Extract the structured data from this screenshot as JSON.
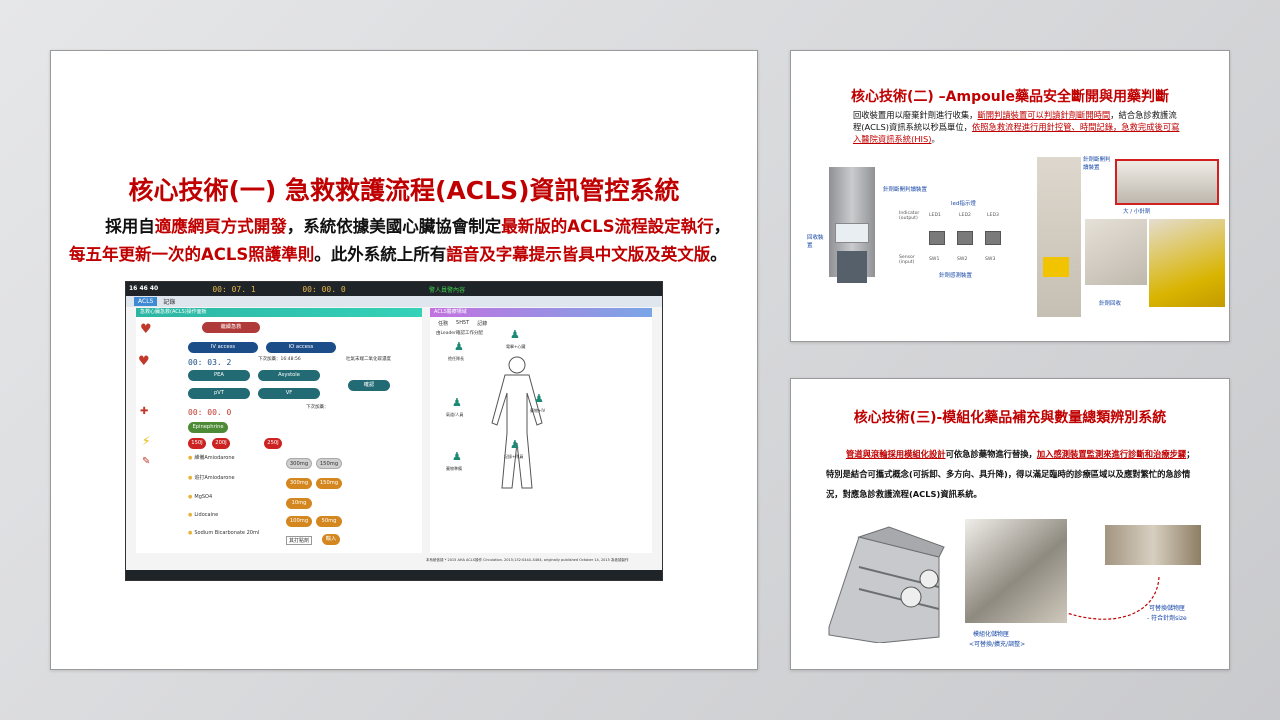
{
  "slide1": {
    "title": "核心技術(一) 急救救護流程(ACLS)資訊管控系統",
    "body": {
      "p1_a": "採用自",
      "p1_b": "適應網頁方式開發",
      "p1_c": "，系統依據美國心臟協會制定",
      "p1_d": "最新版的ACLS流程設定執行",
      "p1_e": "，",
      "p2_a": "每五年更新一次的ACLS照護準則",
      "p2_b": "。此外系統上所有",
      "p2_c": "語音及字幕提示皆具中文版及英文版",
      "p2_d": "。"
    },
    "acls": {
      "clock": "16 46 40",
      "timer1": "00: 07. 1",
      "timer2": "00: 00. 0",
      "alarm": "警人員警內容",
      "tab1": "ACLS",
      "tab2": "記錄",
      "left_header": "急救心臟急救(ACLS)操作面板",
      "right_header": "ACLS醫療場域",
      "cpr_btn": "繼續急救",
      "iv": "IV access",
      "io": "IO access",
      "time_label": "下次加藥：16:48:56",
      "timer_a": "00: 03. 2",
      "pea": "PEA",
      "asys": "Asystole",
      "pvt": "pVT",
      "vf": "VF",
      "co2": "吐氣末端二氧化碳濃度",
      "confirm": "確認",
      "next": "下次加藥：",
      "timer_b": "00: 00. 0",
      "epi": "Epinephrine",
      "j150": "150J",
      "j200": "200J",
      "j250": "250J",
      "drugs": [
        "維備Amiodarone",
        "追打Amiodarone",
        "MgSO4",
        "Lidocaine",
        "Sodium Bicarbonate 20ml"
      ],
      "d300a": "300mg",
      "d150a": "150mg",
      "d300b": "300mg",
      "d150b": "150mg",
      "d10": "10mg",
      "d100": "100mg",
      "d50": "50mg",
      "other": "其打點劑",
      "input": "輸入",
      "rtabs": [
        "任務",
        "5H5T",
        "記錄"
      ],
      "leader": "由Leader確認工作分配",
      "roles": [
        "擔任隊長",
        "電擊+心臟",
        "氣道/人員",
        "藥物+IV",
        "藥物準備",
        "記錄+隊員"
      ],
      "footer": "本系統依據 * 2015 AHA ACLS操作 Circulation. 2015;132:S444–S464, originally published October 14, 2015 為依據製作"
    }
  },
  "slide2": {
    "title": "核心技術(二) –Ampoule藥品安全斷開與用藥判斷",
    "b1": "回收裝置用以廢棄針劑進行收集，",
    "b2": "斷開判讀裝置可以判讀針劑斷開時間",
    "b3": "，結合急診救護流程(ACLS)資訊系統以秒爲單位，",
    "b4": "依照急救流程進行用針控管、時間記錄，急救完成後可寫入醫院資訊系統(HIS)",
    "b5": "。",
    "cap_break": "針劑斷開判讀裝置",
    "cap_recycle": "回收裝置",
    "led_title": "led指示燈",
    "indicator": "Indicator (output)",
    "sensor": "Sensor (input)",
    "leds": [
      "LED1",
      "LED2",
      "LED3"
    ],
    "sws": [
      "SW1",
      "SW2",
      "SW3"
    ],
    "cap_sensor": "針劑感測裝置",
    "cap_break2": "針劑斷開判讀裝置",
    "cap_size": "大 / 小針劑",
    "cap_collect": "針劑回收"
  },
  "slide3": {
    "title": "核心技術(三)-模組化藥品補充與數量總類辨別系統",
    "b1": "管道與滾輪採用模組化設計",
    "b2": "可依急診藥物進行替換，",
    "b3": "加入感測裝置監測來進行診斷和治療步驟",
    "b4": "；特別是結合可攜式概念(可拆卸、多方向、具升降)，得以滿足臨時的診療區域以及應對繁忙的急診情況，對應急診救護流程(ACLS)資訊系統。",
    "cap_module": "模組化儲物匣",
    "cap_module2": "<可替換/擴充/調整>",
    "cap_swap": "可替換儲物匣",
    "cap_swap2": "- 符合針劑size"
  }
}
